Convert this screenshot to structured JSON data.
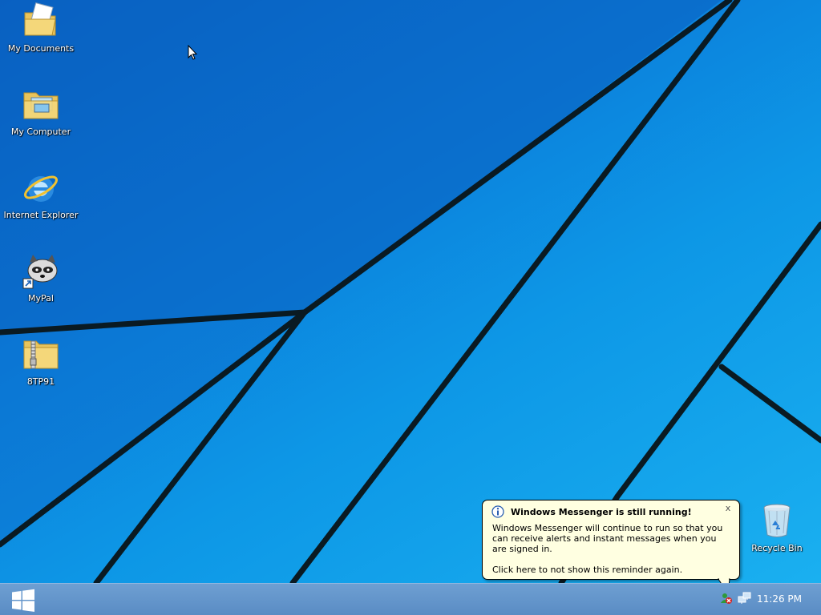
{
  "desktop": {
    "icons": [
      {
        "label": "My Documents",
        "icon": "documents-folder-icon"
      },
      {
        "label": "My Computer",
        "icon": "computer-folder-icon"
      },
      {
        "label": "Internet Explorer",
        "icon": "internet-explorer-icon"
      },
      {
        "label": "MyPal",
        "icon": "mypal-raccoon-icon"
      },
      {
        "label": "8TP91",
        "icon": "zip-folder-icon"
      },
      {
        "label": "Recycle Bin",
        "icon": "recycle-bin-icon"
      }
    ]
  },
  "balloon": {
    "title": "Windows Messenger is still running!",
    "body": "Windows Messenger will continue to run so that you can receive alerts and instant messages when you are signed in.",
    "hint": "Click here to not show this reminder again.",
    "close_label": "x"
  },
  "taskbar": {
    "clock": "11:26 PM",
    "tray": [
      "messenger-icon",
      "network-icon"
    ]
  },
  "colors": {
    "taskbar": "#5a8cc4",
    "balloon_bg": "#ffffe1",
    "desktop_blue": "#0d97e6"
  }
}
